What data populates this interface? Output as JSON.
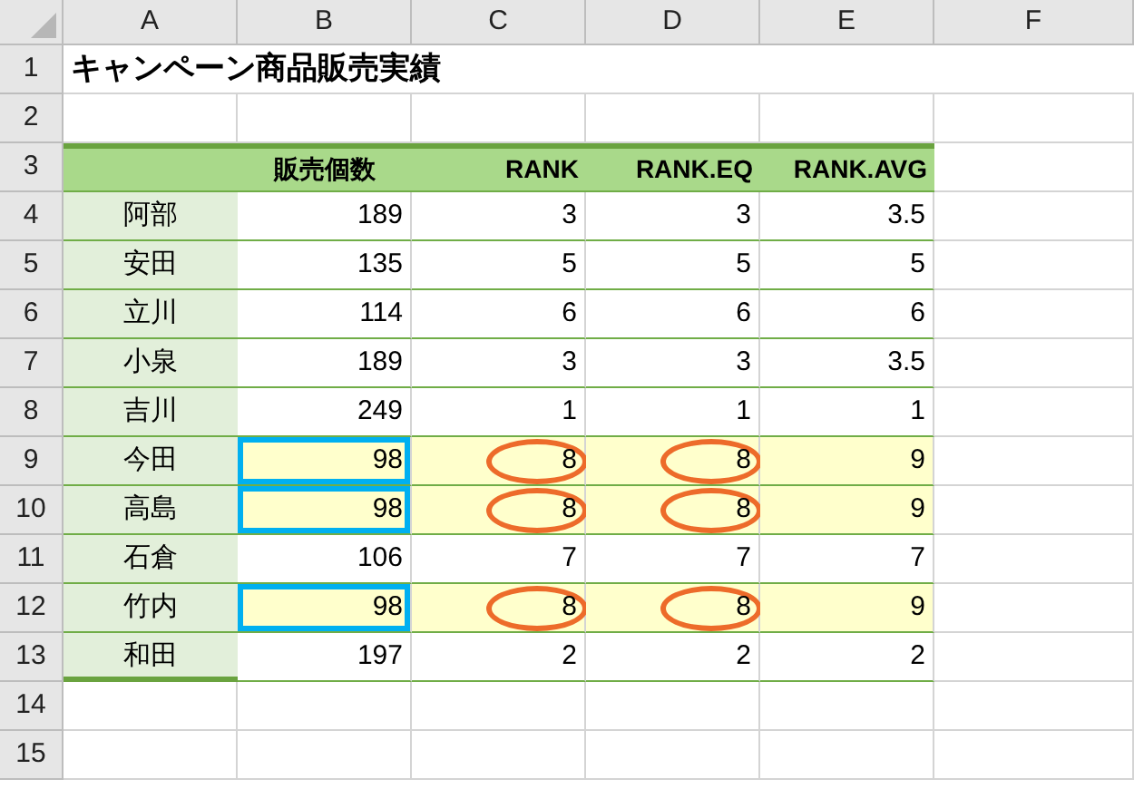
{
  "column_headers": [
    "A",
    "B",
    "C",
    "D",
    "E",
    "F"
  ],
  "row_numbers": [
    "1",
    "2",
    "3",
    "4",
    "5",
    "6",
    "7",
    "8",
    "9",
    "10",
    "11",
    "12",
    "13",
    "14",
    "15"
  ],
  "title": "キャンペーン商品販売実績",
  "table": {
    "headers": [
      "販売個数",
      "RANK",
      "RANK.EQ",
      "RANK.AVG"
    ],
    "rows": [
      {
        "name": "阿部",
        "sales": "189",
        "rank": "3",
        "rank_eq": "3",
        "rank_avg": "3.5",
        "highlighted": false
      },
      {
        "name": "安田",
        "sales": "135",
        "rank": "5",
        "rank_eq": "5",
        "rank_avg": "5",
        "highlighted": false
      },
      {
        "name": "立川",
        "sales": "114",
        "rank": "6",
        "rank_eq": "6",
        "rank_avg": "6",
        "highlighted": false
      },
      {
        "name": "小泉",
        "sales": "189",
        "rank": "3",
        "rank_eq": "3",
        "rank_avg": "3.5",
        "highlighted": false
      },
      {
        "name": "吉川",
        "sales": "249",
        "rank": "1",
        "rank_eq": "1",
        "rank_avg": "1",
        "highlighted": false
      },
      {
        "name": "今田",
        "sales": "98",
        "rank": "8",
        "rank_eq": "8",
        "rank_avg": "9",
        "highlighted": true
      },
      {
        "name": "高島",
        "sales": "98",
        "rank": "8",
        "rank_eq": "8",
        "rank_avg": "9",
        "highlighted": true
      },
      {
        "name": "石倉",
        "sales": "106",
        "rank": "7",
        "rank_eq": "7",
        "rank_avg": "7",
        "highlighted": false
      },
      {
        "name": "竹内",
        "sales": "98",
        "rank": "8",
        "rank_eq": "8",
        "rank_avg": "9",
        "highlighted": true
      },
      {
        "name": "和田",
        "sales": "197",
        "rank": "2",
        "rank_eq": "2",
        "rank_avg": "2",
        "highlighted": false
      }
    ]
  }
}
